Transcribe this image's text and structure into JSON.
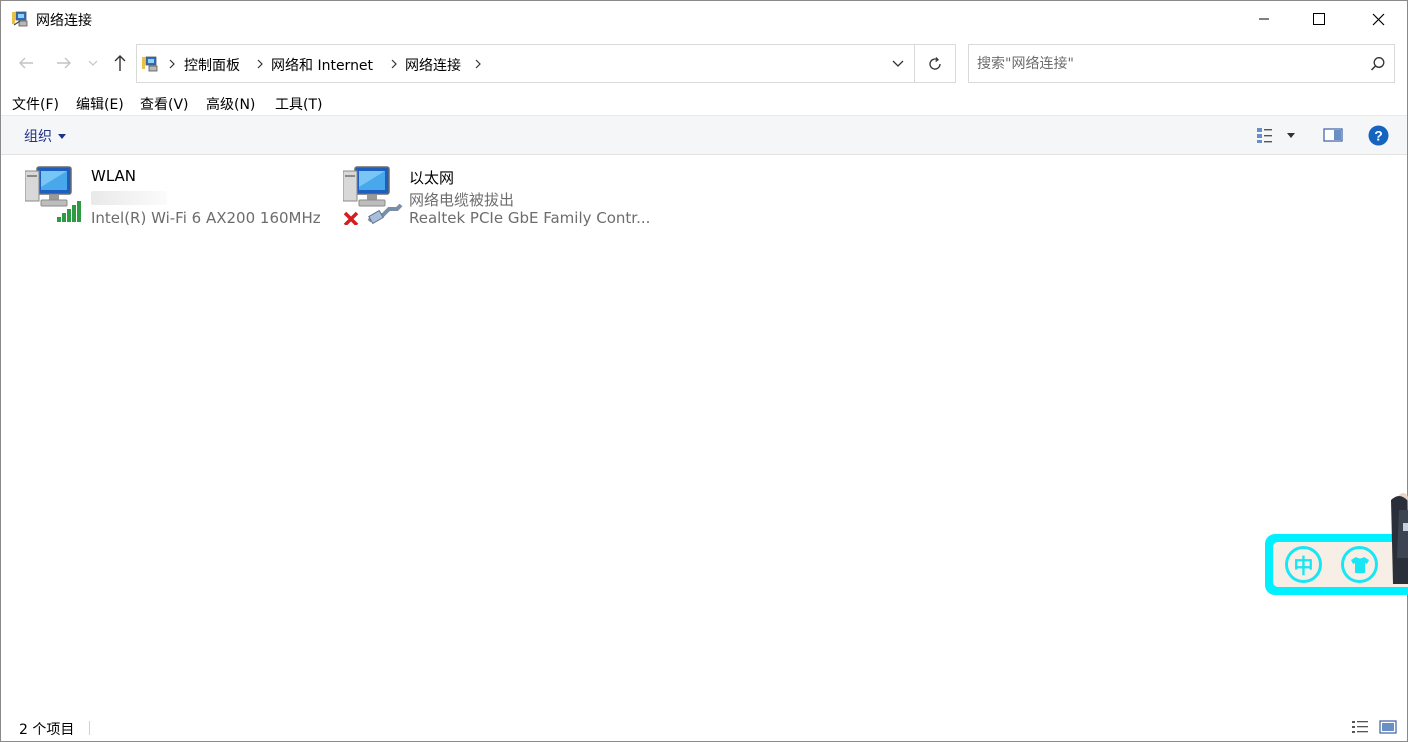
{
  "window": {
    "title": "网络连接",
    "icon": "network-connections-icon"
  },
  "address": {
    "breadcrumbs": [
      "控制面板",
      "网络和 Internet",
      "网络连接"
    ]
  },
  "search": {
    "placeholder": "搜索\"网络连接\""
  },
  "menu": {
    "items": [
      "文件(F)",
      "编辑(E)",
      "查看(V)",
      "高级(N)",
      "工具(T)"
    ]
  },
  "toolbar": {
    "organize_label": "组织"
  },
  "connections": [
    {
      "name": "WLAN",
      "status": "",
      "adapter": "Intel(R) Wi-Fi 6 AX200 160MHz",
      "icon": "wlan-adapter-icon"
    },
    {
      "name": "以太网",
      "status": "网络电缆被拔出",
      "adapter": "Realtek PCIe GbE Family Contr...",
      "icon": "ethernet-disconnected-icon"
    }
  ],
  "statusbar": {
    "item_count": "2 个项目"
  },
  "widget": {
    "button1_label": "中"
  },
  "colors": {
    "accent": "#1e3287",
    "widget_border": "#00f0ff",
    "help_blue": "#1564c0"
  }
}
